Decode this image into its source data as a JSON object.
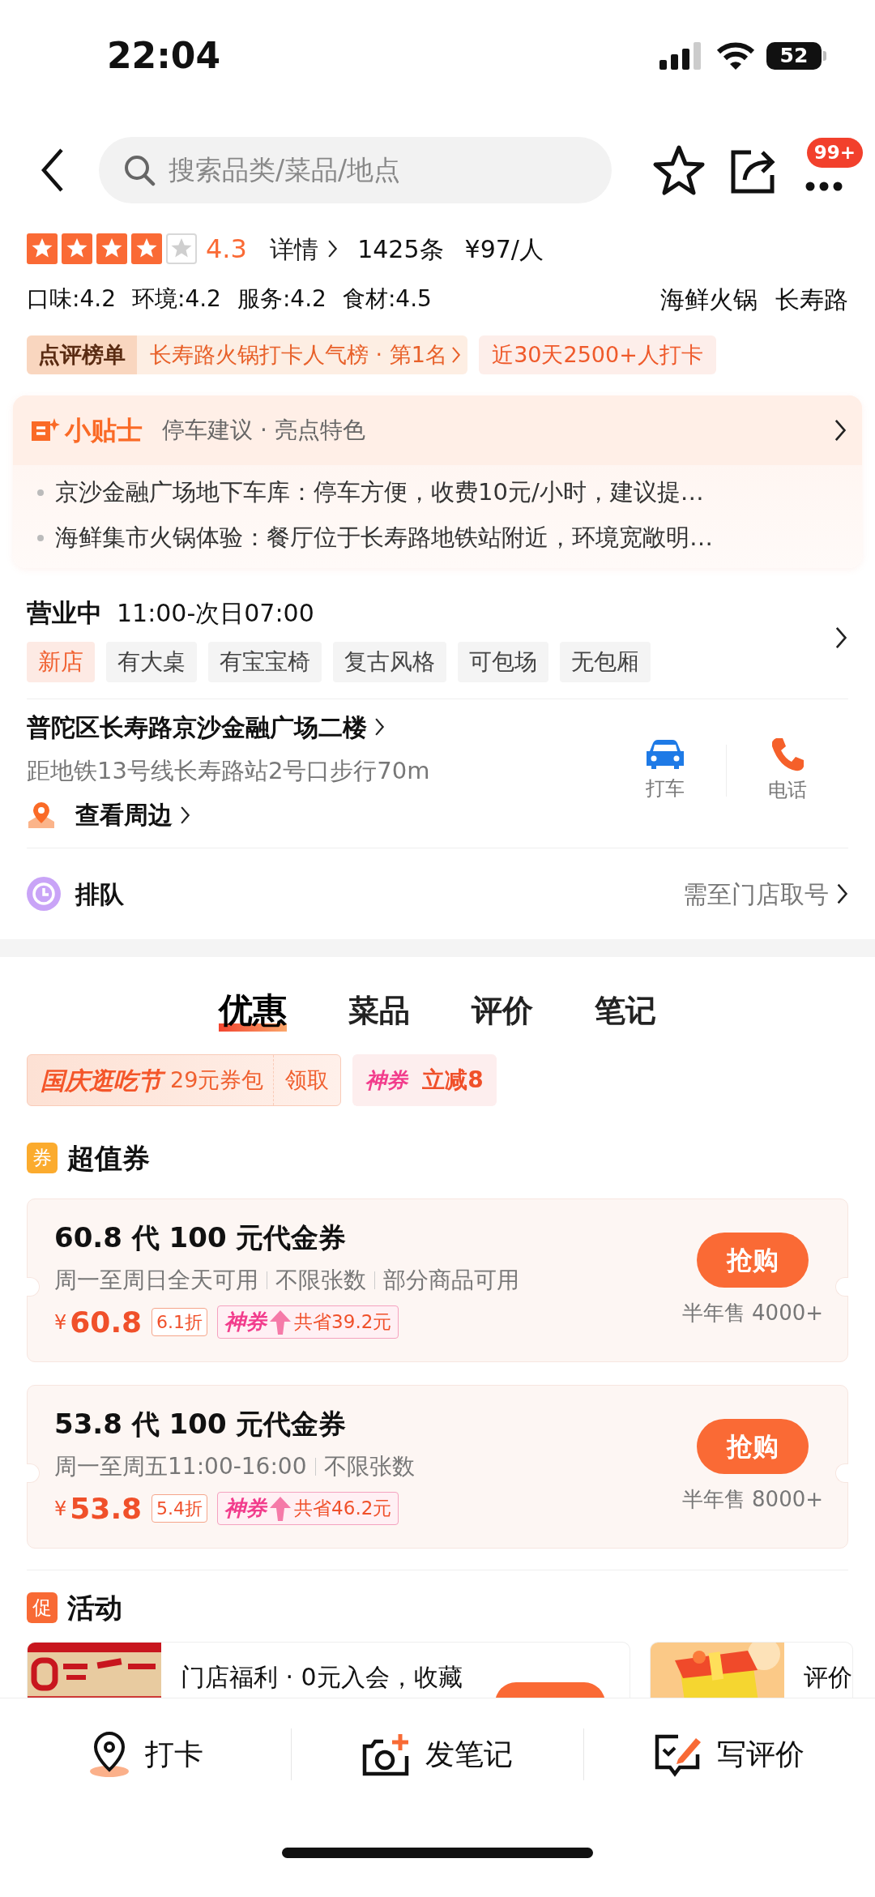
{
  "status_bar": {
    "time": "22:04",
    "battery": "52"
  },
  "header": {
    "search": {
      "placeholder": "搜索品类/菜品/地点"
    },
    "badge": "99+"
  },
  "rating": {
    "stars": 4,
    "score": "4.3",
    "details": "详情",
    "reviews": "1425条",
    "price": "¥97/人"
  },
  "scores": [
    "口味:4.2",
    "环境:4.2",
    "服务:4.2",
    "食材:4.5"
  ],
  "categories": [
    "海鲜火锅",
    "长寿路"
  ],
  "ranking": {
    "label": "点评榜单",
    "text": "长寿路火锅打卡人气榜 · 第1名",
    "checkins": "近30天2500+人打卡"
  },
  "tips": {
    "title": "小贴士",
    "subtitle": "停车建议 · 亮点特色",
    "items": [
      "京沙金融广场地下车库：停车方便，收费10元/小时，建议提…",
      "海鲜集市火锅体验：餐厅位于长寿路地铁站附近，环境宽敞明…"
    ]
  },
  "hours": {
    "status": "营业中",
    "time": "11:00-次日07:00",
    "tags": [
      {
        "label": "新店",
        "highlight": true
      },
      {
        "label": "有大桌",
        "highlight": false
      },
      {
        "label": "有宝宝椅",
        "highlight": false
      },
      {
        "label": "复古风格",
        "highlight": false
      },
      {
        "label": "可包场",
        "highlight": false
      },
      {
        "label": "无包厢",
        "highlight": false
      }
    ]
  },
  "address": {
    "text": "普陀区长寿路京沙金融广场二楼",
    "metro": "距地铁13号线长寿路站2号口步行70m",
    "nearby": "查看周边",
    "actions": [
      {
        "kind": "car",
        "label": "打车"
      },
      {
        "kind": "phone",
        "label": "电话"
      }
    ]
  },
  "queue": {
    "label": "排队",
    "hint": "需至门店取号"
  },
  "tabs": [
    {
      "label": "优惠",
      "selected": true
    },
    {
      "label": "菜品",
      "selected": false
    },
    {
      "label": "评价",
      "selected": false
    },
    {
      "label": "笔记",
      "selected": false
    }
  ],
  "promos": {
    "festival": "国庆逛吃节",
    "pack": "29元券包",
    "claim": "领取",
    "super_label": "神券",
    "super_text": "立减8"
  },
  "vouchers_section": {
    "icon": "券",
    "title": "超值券"
  },
  "vouchers": [
    {
      "title": "60.8 代 100 元代金券",
      "conditions": [
        "周一至周日全天可用",
        "不限张数",
        "部分商品可用"
      ],
      "currency": "¥",
      "price": "60.8",
      "discount": "6.1折",
      "super": "神券",
      "saving": "共省39.2元",
      "button": "抢购",
      "sales": "半年售 4000+"
    },
    {
      "title": "53.8 代 100 元代金券",
      "conditions": [
        "周一至周五11:00-16:00",
        "不限张数"
      ],
      "currency": "¥",
      "price": "53.8",
      "discount": "5.4折",
      "super": "神券",
      "saving": "共省46.2元",
      "button": "抢购",
      "sales": "半年售 8000+"
    }
  ],
  "activities_section": {
    "icon": "促",
    "title": "活动"
  },
  "activities": [
    {
      "kind": "picture",
      "text": "门店福利 · 0元入会，收藏",
      "has_button": true
    },
    {
      "kind": "picture",
      "text": "评价"
    }
  ],
  "bottom_bar": [
    {
      "kind": "pin",
      "label": "打卡"
    },
    {
      "kind": "camera",
      "label": "发笔记"
    },
    {
      "kind": "edit",
      "label": "写评价"
    }
  ]
}
